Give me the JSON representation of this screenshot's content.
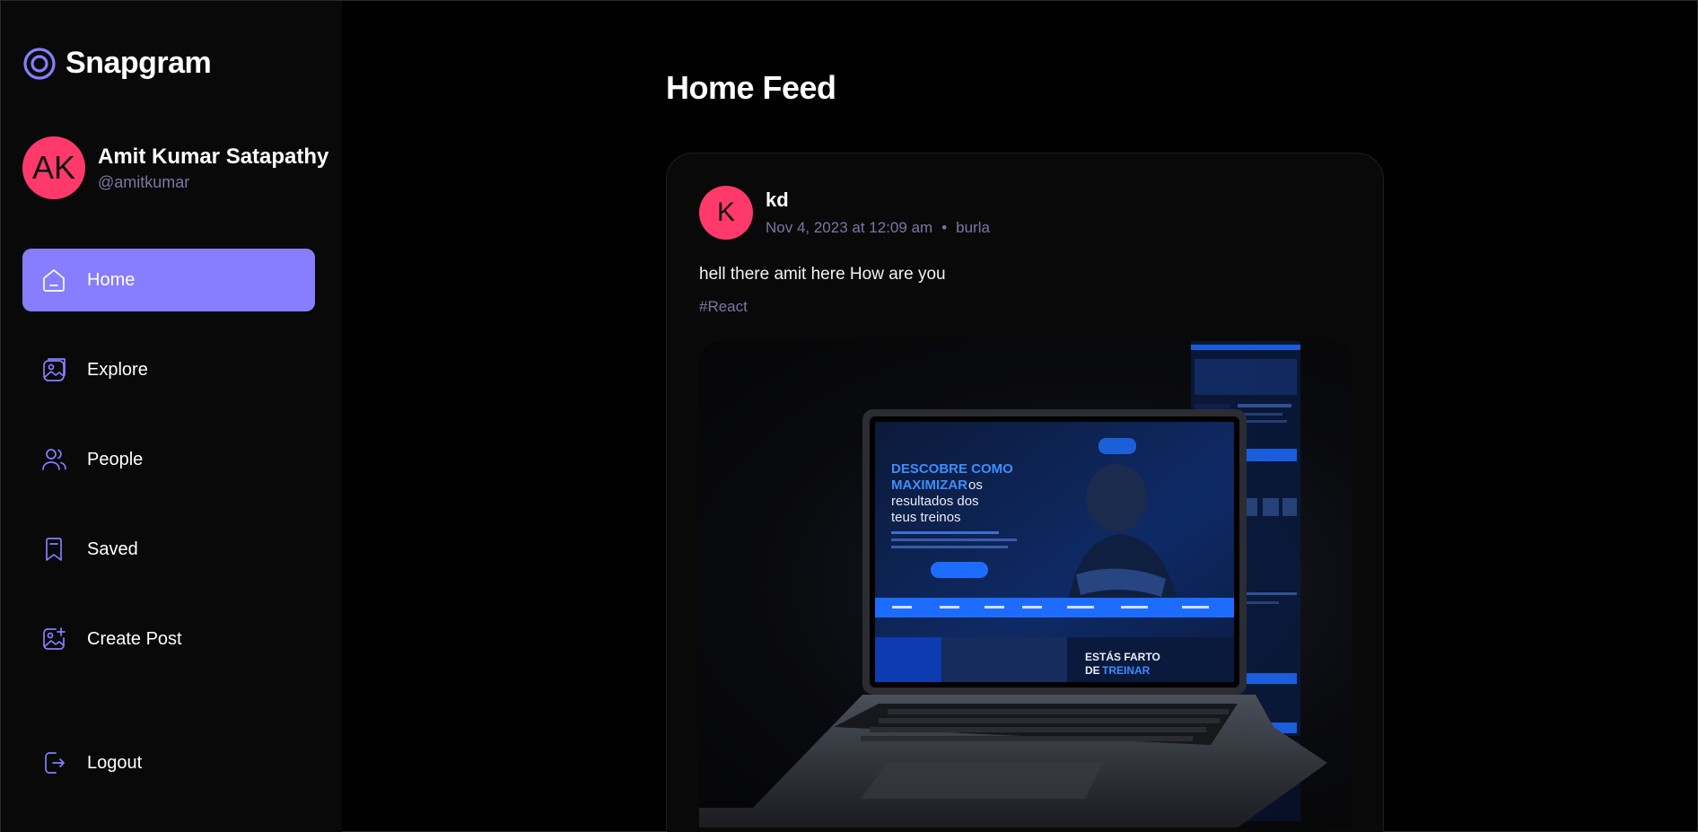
{
  "app": {
    "name": "Snapgram"
  },
  "user": {
    "initials": "AK",
    "name": "Amit Kumar Satapathy",
    "handle": "@amitkumar"
  },
  "nav": {
    "items": [
      {
        "label": "Home",
        "icon": "home-icon",
        "active": true
      },
      {
        "label": "Explore",
        "icon": "gallery-icon",
        "active": false
      },
      {
        "label": "People",
        "icon": "people-icon",
        "active": false
      },
      {
        "label": "Saved",
        "icon": "bookmark-icon",
        "active": false
      },
      {
        "label": "Create Post",
        "icon": "gallery-add-icon",
        "active": false
      }
    ],
    "logout": {
      "label": "Logout",
      "icon": "logout-icon"
    }
  },
  "main": {
    "title": "Home Feed",
    "post": {
      "author_initial": "K",
      "author": "kd",
      "date": "Nov 4, 2023 at 12:09 am",
      "separator": "•",
      "location": "burla",
      "caption": "hell there amit here How are you",
      "tag": "#React",
      "image": {
        "headline_1": "DESCOBRE COMO",
        "headline_2": "MAXIMIZAR",
        "headline_2b": "os",
        "headline_3": "resultados dos",
        "headline_4": "teus treinos",
        "banner_1": "ESTÁS FARTO",
        "banner_2a": "DE",
        "banner_2b": "TREINAR"
      }
    }
  },
  "colors": {
    "accent": "#877eff",
    "avatar": "#ff3a6b",
    "muted": "#7878a3",
    "sidebar": "#09090a"
  }
}
